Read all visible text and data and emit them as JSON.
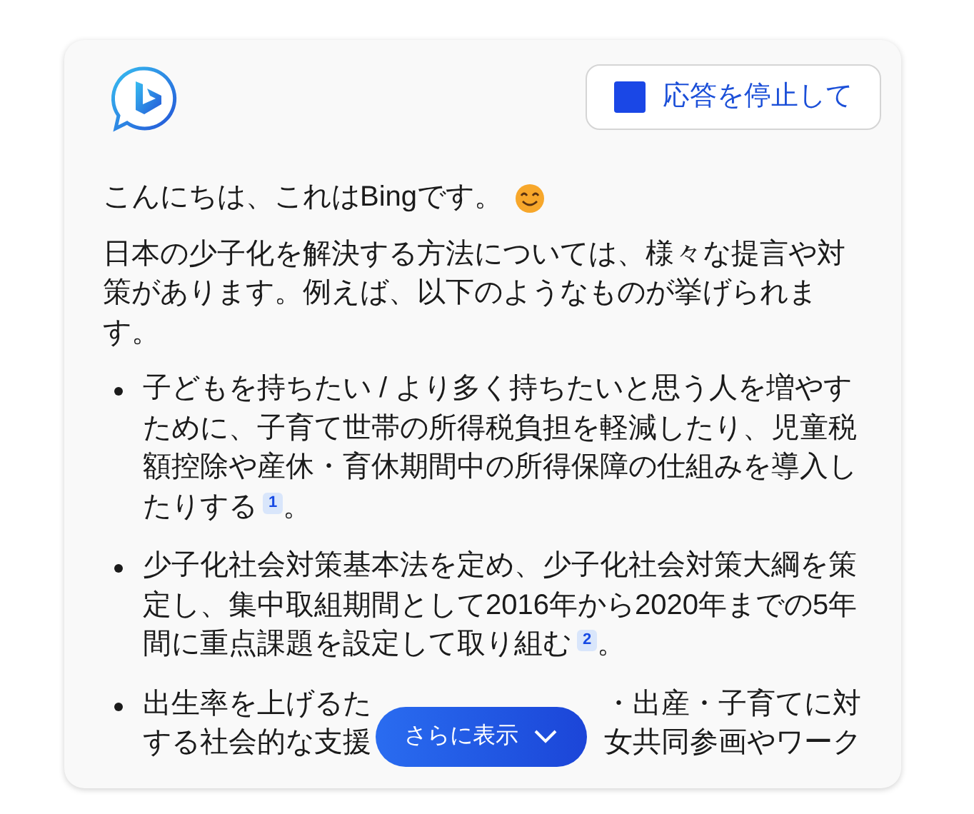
{
  "stop_button": {
    "label": "応答を停止して"
  },
  "greeting": "こんにちは、これはBingです。",
  "intro": "日本の少子化を解決する方法については、様々な提言や対策があります。例えば、以下のようなものが挙げられます。",
  "items": [
    {
      "kind": "full",
      "text": "子どもを持ちたい / より多く持ちたいと思う人を増やすために、子育て世帯の所得税負担を軽減したり、児童税額控除や産休・育休期間中の所得保障の仕組みを導入したりする",
      "citation": "1",
      "after": "。"
    },
    {
      "kind": "full",
      "text": "少子化社会対策基本法を定め、少子化社会対策大綱を策定し、集中取組期間として2016年から2020年までの5年間に重点課題を設定して取り組む",
      "citation": "2",
      "after": "。"
    },
    {
      "kind": "covered",
      "lines": [
        {
          "text": "出生率を上げるた",
          "text_after_gap": "・出産・子育てに対"
        },
        {
          "text": "する社会的な支援",
          "text_after_gap": "女共同参画やワーク"
        }
      ]
    }
  ],
  "show_more_button": {
    "label": "さらに表示"
  }
}
